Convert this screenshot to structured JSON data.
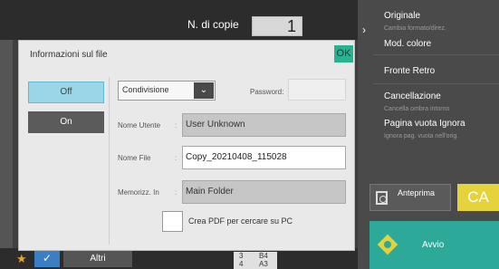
{
  "header": {
    "copies_label": "N. di copie",
    "copies_value": "1"
  },
  "right_panel": {
    "items": [
      {
        "label": "Originale",
        "sub": "Cambia formato/direz."
      },
      {
        "label": "Mod. colore",
        "sub": ""
      },
      {
        "label": "Fronte Retro",
        "sub": ""
      },
      {
        "label": "Cancellazione",
        "sub": "Cancella ombra intorno"
      },
      {
        "label": "Pagina vuota Ignora",
        "sub": "Ignora pag. vuota nell'orig."
      }
    ],
    "preview_label": "Anteprima",
    "ca_label": "CA",
    "start_label": "Avvio"
  },
  "bottom_bar": {
    "other_label": "Altri",
    "tray": [
      {
        "num": "3",
        "size": "B4"
      },
      {
        "num": "4",
        "size": "A3"
      }
    ]
  },
  "dialog": {
    "title": "Informazioni sul file",
    "ok_label": "OK",
    "off_label": "Off",
    "on_label": "On",
    "share_select": "Condivisione",
    "password_label": "Password:",
    "password_value": "",
    "user_label": "Nome Utente",
    "user_value": "User Unknown",
    "file_label": "Nome File",
    "file_value": "Copy_20210408_115028",
    "folder_label": "Memorizz. In",
    "folder_value": "Main Folder",
    "pdf_label": "Crea PDF per cercare su PC",
    "separator": ":"
  },
  "colors": {
    "accent_teal": "#27b292",
    "toggle_active": "#9ad6e8",
    "start_button": "#2da99a",
    "ca_button": "#e6d23a"
  },
  "icons": [
    "chevron-right-icon",
    "chevron-down-icon",
    "preview-icon",
    "start-icon",
    "star-icon",
    "check-icon"
  ]
}
